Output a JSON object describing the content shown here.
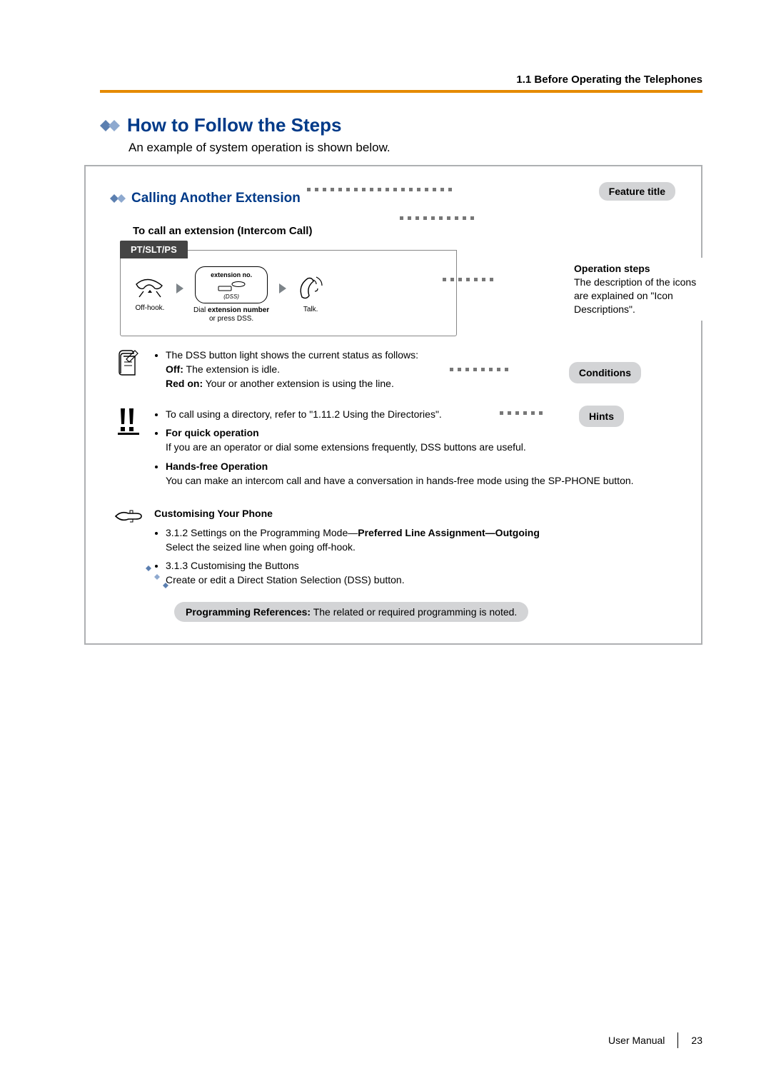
{
  "header": {
    "breadcrumb": "1.1 Before Operating the Telephones"
  },
  "main": {
    "title": "How to Follow the Steps",
    "intro": "An example of system operation is shown below."
  },
  "example": {
    "feature_heading": "Calling Another Extension",
    "subtitle": "To call an extension (Intercom Call)",
    "tab": "PT/SLT/PS",
    "labels": {
      "feature_title": "Feature title",
      "operation_title": "Operation steps",
      "operation_desc": "The description of the icons are explained on \"Icon Descriptions\".",
      "conditions": "Conditions",
      "hints": "Hints"
    },
    "steps": {
      "s1_caption": "Off-hook.",
      "s2_title": "extension no.",
      "s2_sub": "(DSS)",
      "s2_caption_line1": "Dial extension number",
      "s2_caption_line2": "or press DSS.",
      "s3_caption": "Talk."
    },
    "conditions": {
      "line1": "The DSS button light shows the current status as follows:",
      "off_label": "Off:",
      "off_text": " The extension is idle.",
      "red_label": "Red on:",
      "red_text": " Your or another extension is using the line."
    },
    "hints": {
      "h1": "To call using a directory, refer to \"1.11.2 Using the Directories\".",
      "h2_title": "For quick operation",
      "h2_text": "If you are an operator or dial some extensions frequently, DSS buttons are useful.",
      "h3_title": "Hands-free Operation",
      "h3_text": "You can make an intercom call and have a conversation in hands-free mode using the SP-PHONE button."
    },
    "customise": {
      "title": "Customising Your Phone",
      "c1_ref": "3.1.2 Settings on the Programming Mode—",
      "c1_bold": "Preferred Line Assignment—Outgoing",
      "c1_text": "Select the seized line when going off-hook.",
      "c2_ref": "3.1.3 Customising the Buttons",
      "c2_text": "Create or edit a Direct Station Selection (DSS) button."
    },
    "prog_ref_label": "Programming References:",
    "prog_ref_text": " The related or required programming is noted."
  },
  "footer": {
    "manual": "User Manual",
    "page": "23"
  },
  "colors": {
    "accent_blue": "#003a88",
    "accent_orange": "#e58a00",
    "chip_grey": "#d3d4d6"
  }
}
